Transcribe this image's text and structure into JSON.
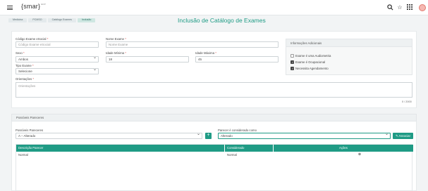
{
  "header": {
    "logo": "{smar}",
    "logo_suffix": "ERP"
  },
  "breadcrumbs": [
    "Medicina",
    "PCMSO",
    "Catálogo Exames",
    "Inclusão"
  ],
  "page_title": "Inclusão de Catálogo de Exames",
  "form": {
    "codigo": {
      "label": "Código Exame eSocial",
      "required": "*",
      "placeholder": "Código Exame eSocial"
    },
    "nome": {
      "label": "Nome Exame",
      "required": "*",
      "placeholder": "Nome Exame"
    },
    "sexo": {
      "label": "Sexo",
      "required": "*",
      "value": "Ambos"
    },
    "idade_minima": {
      "label": "Idade Mínima",
      "required": "*",
      "value": "18"
    },
    "idade_maxima": {
      "label": "Idade Máxima",
      "required": "*",
      "value": "45"
    },
    "tipo": {
      "label": "Tipo Exame",
      "required": "*",
      "value": "Selecione"
    },
    "orientacoes": {
      "label": "Orientações",
      "required": "*",
      "placeholder": "Orientações",
      "counter": "0 / 2000"
    }
  },
  "info": {
    "title": "Informações Adicionais",
    "checks": [
      {
        "label": "Exame é uma Audiometria",
        "checked": false
      },
      {
        "label": "Exame é Ocupacional",
        "checked": true
      },
      {
        "label": "Necessita Agendamento",
        "checked": true
      }
    ]
  },
  "pareceres": {
    "section_title": "Possíveis Pareceres",
    "select_label": "Possíveis Pareceres",
    "select_value": "A – Alterado",
    "consider_label": "Parecer é considerado como",
    "consider_value": "Alterado",
    "associate_button": "Associar",
    "table": {
      "headers": [
        "Descrição Parecer",
        "Considerado",
        "Ações"
      ],
      "rows": [
        {
          "descricao": "Normal",
          "considerado": "Normal"
        }
      ]
    }
  }
}
